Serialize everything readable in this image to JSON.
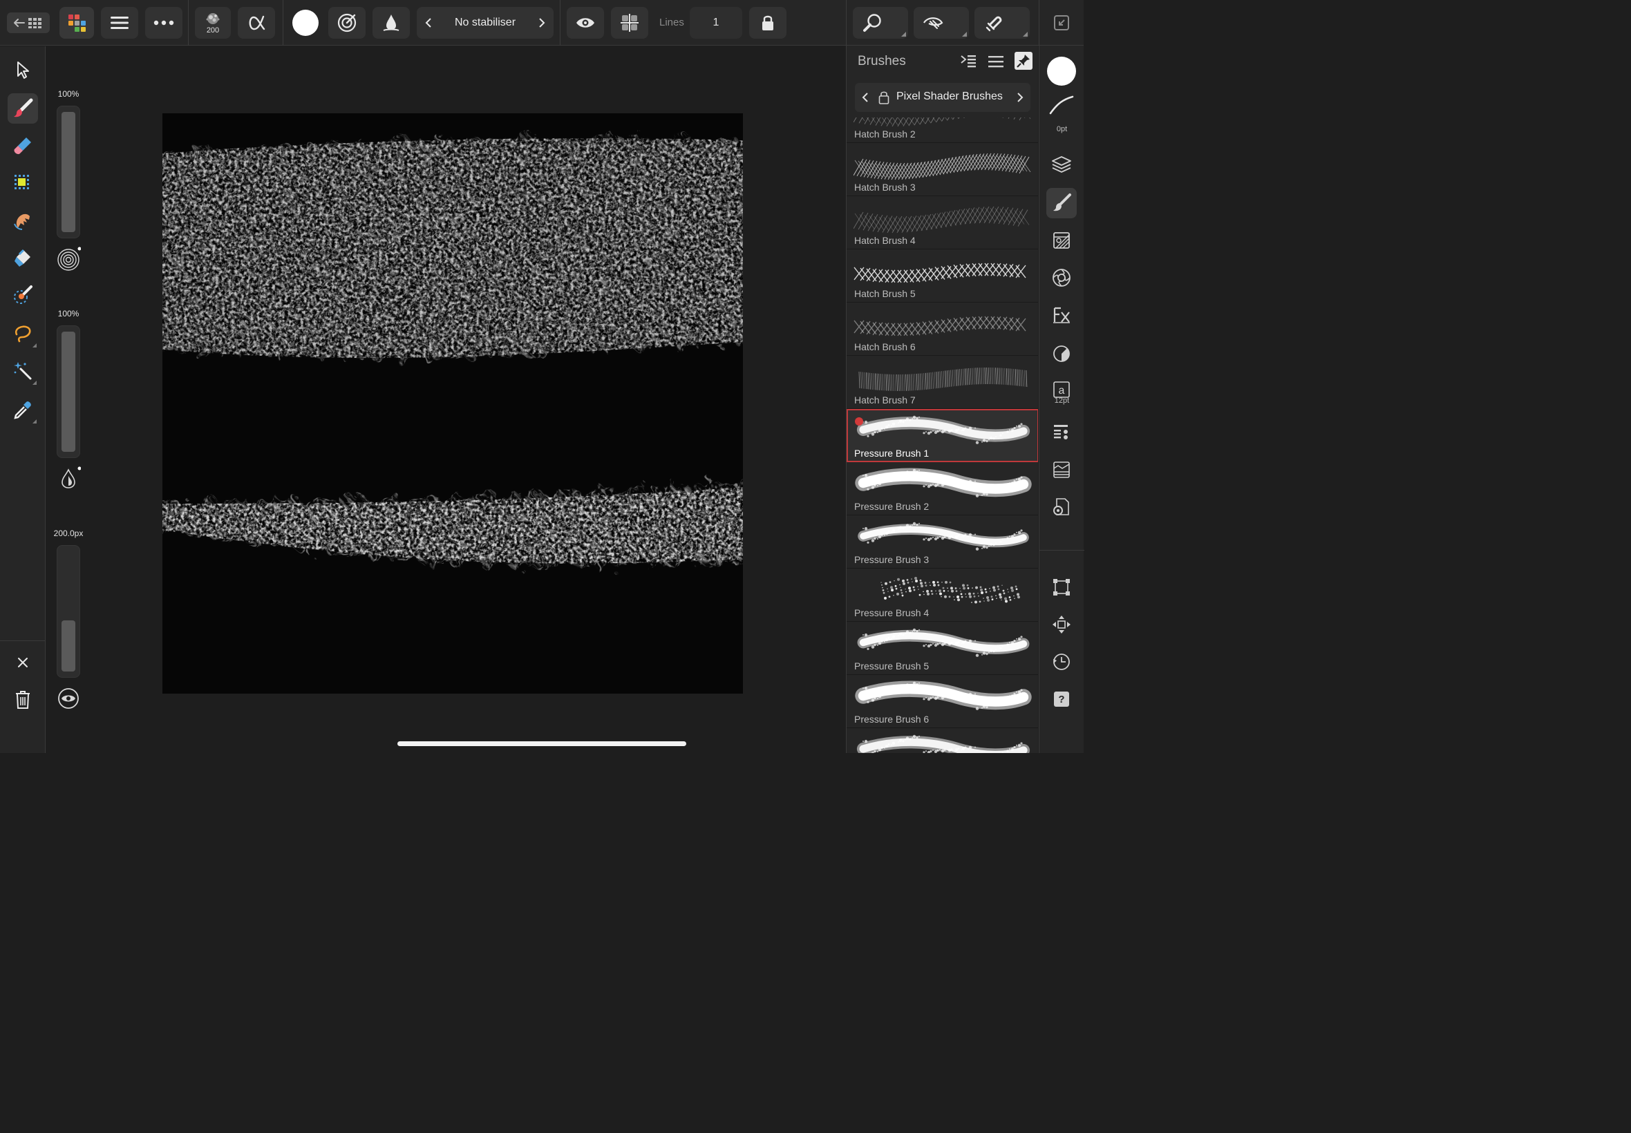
{
  "toolbar": {
    "brush_size_badge": "200",
    "stabiliser_label": "No stabiliser",
    "lines_label": "Lines",
    "lines_value": "1"
  },
  "sliders": {
    "opacity_label": "100%",
    "opacity_value": 1.0,
    "flow_label": "100%",
    "flow_value": 1.0,
    "width_label": "200.0px",
    "width_value": 0.42
  },
  "brushes": {
    "title": "Brushes",
    "category": "Pixel Shader Brushes",
    "items": [
      {
        "name": "Hatch Brush 2",
        "style": "hatch-fade"
      },
      {
        "name": "Hatch Brush 3",
        "style": "hatch-dense"
      },
      {
        "name": "Hatch Brush 4",
        "style": "hatch-faint"
      },
      {
        "name": "Hatch Brush 5",
        "style": "cross"
      },
      {
        "name": "Hatch Brush 6",
        "style": "cross-faint"
      },
      {
        "name": "Hatch Brush 7",
        "style": "vertical"
      },
      {
        "name": "Pressure Brush 1",
        "style": "soft",
        "selected": true
      },
      {
        "name": "Pressure Brush 2",
        "style": "soft-bright"
      },
      {
        "name": "Pressure Brush 3",
        "style": "speckle"
      },
      {
        "name": "Pressure Brush 4",
        "style": "dots"
      },
      {
        "name": "Pressure Brush 5",
        "style": "rough"
      },
      {
        "name": "Pressure Brush 6",
        "style": "soft-bright"
      },
      {
        "name": "",
        "style": "soft"
      }
    ]
  },
  "studio": {
    "stroke_width_label": "0pt",
    "text_size_label": "12pt",
    "text_glyph": "a",
    "help_glyph": "?"
  },
  "colors": {
    "accent_selected": "#c0393b",
    "primary_color": "#ffffff"
  }
}
